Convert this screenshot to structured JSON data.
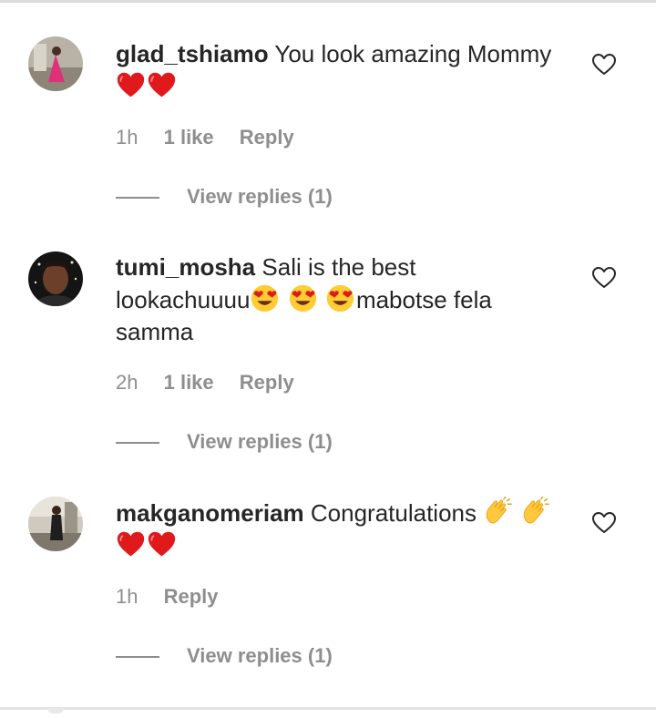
{
  "comments": [
    {
      "username": "glad_tshiamo",
      "text_before": "You look amazing Mommy",
      "emojis_after": [
        "red-heart",
        "red-heart"
      ],
      "time": "1h",
      "likes": "1 like",
      "reply_label": "Reply",
      "view_replies": "View replies (1)"
    },
    {
      "username": "tumi_mosha",
      "text_before": "Sali is the best lookachuuuu",
      "emojis_middle": [
        "heart-eyes",
        "heart-eyes",
        "heart-eyes"
      ],
      "text_after": "mabotse fela samma",
      "time": "2h",
      "likes": "1 like",
      "reply_label": "Reply",
      "view_replies": "View replies (1)"
    },
    {
      "username": "makganomeriam",
      "text_before": "Congratulations",
      "emojis_after": [
        "clapping-hands",
        "clapping-hands",
        "red-heart",
        "red-heart"
      ],
      "time": "1h",
      "reply_label": "Reply",
      "view_replies": "View replies (1)"
    }
  ],
  "colors": {
    "text": "#262626",
    "secondary": "#8e8e8e",
    "heart": "#e0191d",
    "face": "#ffcc33"
  }
}
